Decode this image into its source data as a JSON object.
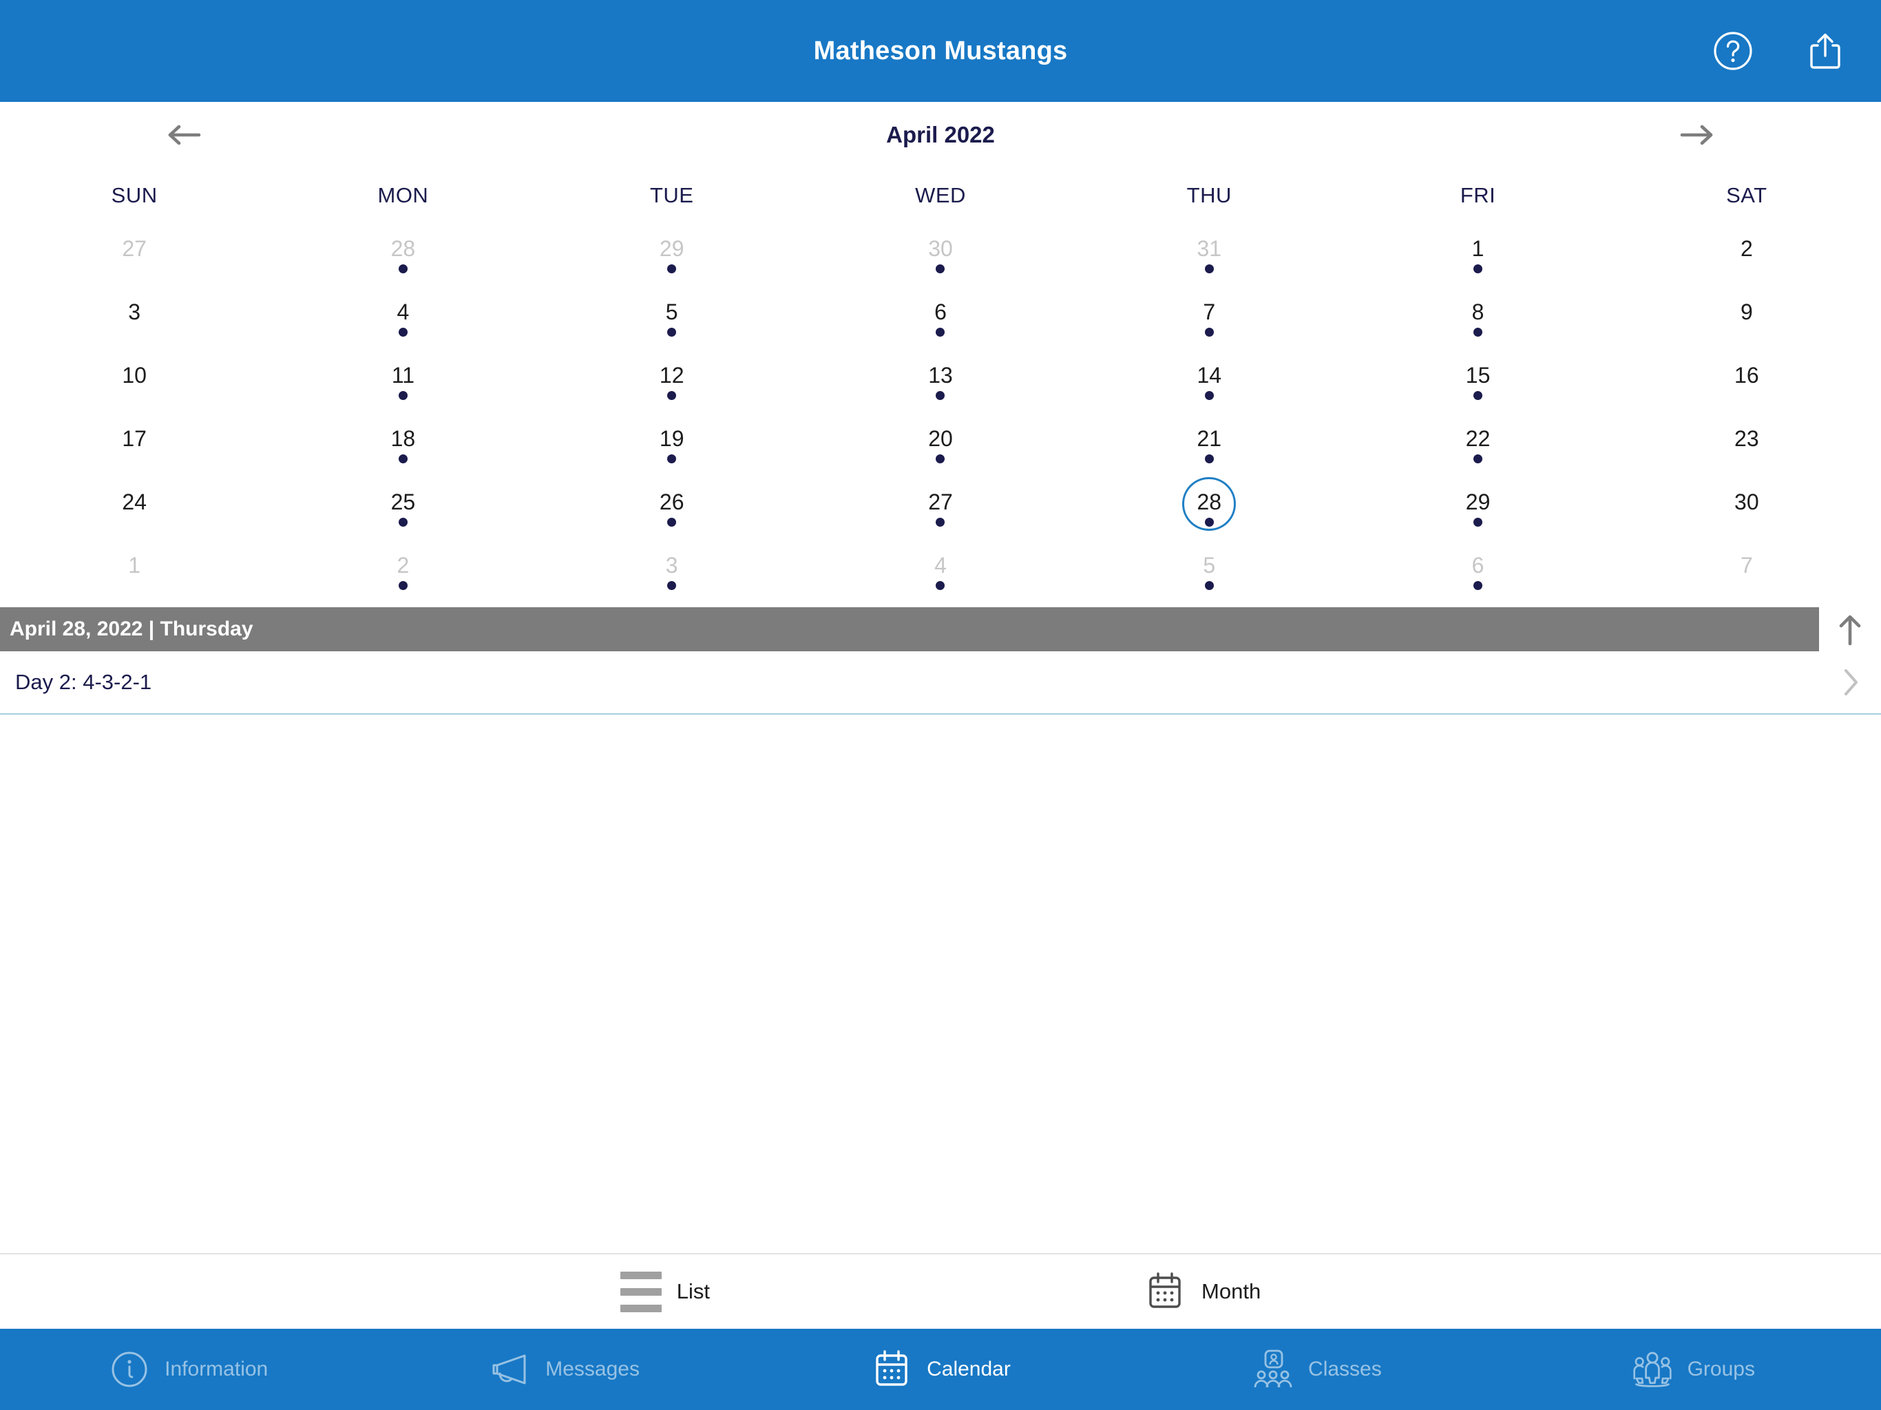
{
  "header": {
    "title": "Matheson Mustangs",
    "help_icon": "question-circle-icon",
    "share_icon": "share-icon"
  },
  "calendar": {
    "month_label": "April 2022",
    "prev_label": "previous-month",
    "next_label": "next-month",
    "weekdays": [
      "SUN",
      "MON",
      "TUE",
      "WED",
      "THU",
      "FRI",
      "SAT"
    ],
    "weeks": [
      [
        {
          "day": "27",
          "muted": true,
          "dot": false,
          "selected": false
        },
        {
          "day": "28",
          "muted": true,
          "dot": true,
          "selected": false
        },
        {
          "day": "29",
          "muted": true,
          "dot": true,
          "selected": false
        },
        {
          "day": "30",
          "muted": true,
          "dot": true,
          "selected": false
        },
        {
          "day": "31",
          "muted": true,
          "dot": true,
          "selected": false
        },
        {
          "day": "1",
          "muted": false,
          "dot": true,
          "selected": false
        },
        {
          "day": "2",
          "muted": false,
          "dot": false,
          "selected": false
        }
      ],
      [
        {
          "day": "3",
          "muted": false,
          "dot": false,
          "selected": false
        },
        {
          "day": "4",
          "muted": false,
          "dot": true,
          "selected": false
        },
        {
          "day": "5",
          "muted": false,
          "dot": true,
          "selected": false
        },
        {
          "day": "6",
          "muted": false,
          "dot": true,
          "selected": false
        },
        {
          "day": "7",
          "muted": false,
          "dot": true,
          "selected": false
        },
        {
          "day": "8",
          "muted": false,
          "dot": true,
          "selected": false
        },
        {
          "day": "9",
          "muted": false,
          "dot": false,
          "selected": false
        }
      ],
      [
        {
          "day": "10",
          "muted": false,
          "dot": false,
          "selected": false
        },
        {
          "day": "11",
          "muted": false,
          "dot": true,
          "selected": false
        },
        {
          "day": "12",
          "muted": false,
          "dot": true,
          "selected": false
        },
        {
          "day": "13",
          "muted": false,
          "dot": true,
          "selected": false
        },
        {
          "day": "14",
          "muted": false,
          "dot": true,
          "selected": false
        },
        {
          "day": "15",
          "muted": false,
          "dot": true,
          "selected": false
        },
        {
          "day": "16",
          "muted": false,
          "dot": false,
          "selected": false
        }
      ],
      [
        {
          "day": "17",
          "muted": false,
          "dot": false,
          "selected": false
        },
        {
          "day": "18",
          "muted": false,
          "dot": true,
          "selected": false
        },
        {
          "day": "19",
          "muted": false,
          "dot": true,
          "selected": false
        },
        {
          "day": "20",
          "muted": false,
          "dot": true,
          "selected": false
        },
        {
          "day": "21",
          "muted": false,
          "dot": true,
          "selected": false
        },
        {
          "day": "22",
          "muted": false,
          "dot": true,
          "selected": false
        },
        {
          "day": "23",
          "muted": false,
          "dot": false,
          "selected": false
        }
      ],
      [
        {
          "day": "24",
          "muted": false,
          "dot": false,
          "selected": false
        },
        {
          "day": "25",
          "muted": false,
          "dot": true,
          "selected": false
        },
        {
          "day": "26",
          "muted": false,
          "dot": true,
          "selected": false
        },
        {
          "day": "27",
          "muted": false,
          "dot": true,
          "selected": false
        },
        {
          "day": "28",
          "muted": false,
          "dot": true,
          "selected": true
        },
        {
          "day": "29",
          "muted": false,
          "dot": true,
          "selected": false
        },
        {
          "day": "30",
          "muted": false,
          "dot": false,
          "selected": false
        }
      ],
      [
        {
          "day": "1",
          "muted": true,
          "dot": false,
          "selected": false
        },
        {
          "day": "2",
          "muted": true,
          "dot": true,
          "selected": false
        },
        {
          "day": "3",
          "muted": true,
          "dot": true,
          "selected": false
        },
        {
          "day": "4",
          "muted": true,
          "dot": true,
          "selected": false
        },
        {
          "day": "5",
          "muted": true,
          "dot": true,
          "selected": false
        },
        {
          "day": "6",
          "muted": true,
          "dot": true,
          "selected": false
        },
        {
          "day": "7",
          "muted": true,
          "dot": false,
          "selected": false
        }
      ]
    ]
  },
  "selected_day": {
    "bar_text": "April 28, 2022 | Thursday",
    "collapse_icon": "arrow-up-icon",
    "events": [
      {
        "title": "Day 2: 4-3-2-1",
        "chevron": "chevron-right-icon"
      }
    ]
  },
  "view_switch": {
    "list_label": "List",
    "month_label": "Month",
    "list_icon": "list-icon",
    "month_icon": "calendar-icon"
  },
  "tabs": [
    {
      "label": "Information",
      "icon": "info-circle-icon",
      "active": false
    },
    {
      "label": "Messages",
      "icon": "megaphone-icon",
      "active": false
    },
    {
      "label": "Calendar",
      "icon": "calendar-icon",
      "active": true
    },
    {
      "label": "Classes",
      "icon": "classes-icon",
      "active": false
    },
    {
      "label": "Groups",
      "icon": "groups-icon",
      "active": false
    }
  ],
  "colors": {
    "brand_blue": "#1878c5",
    "navy": "#1b1b4d",
    "gray_bar": "#7c7c7c",
    "muted_text": "#c6c6c6",
    "selected_ring": "#1f7fc4"
  }
}
